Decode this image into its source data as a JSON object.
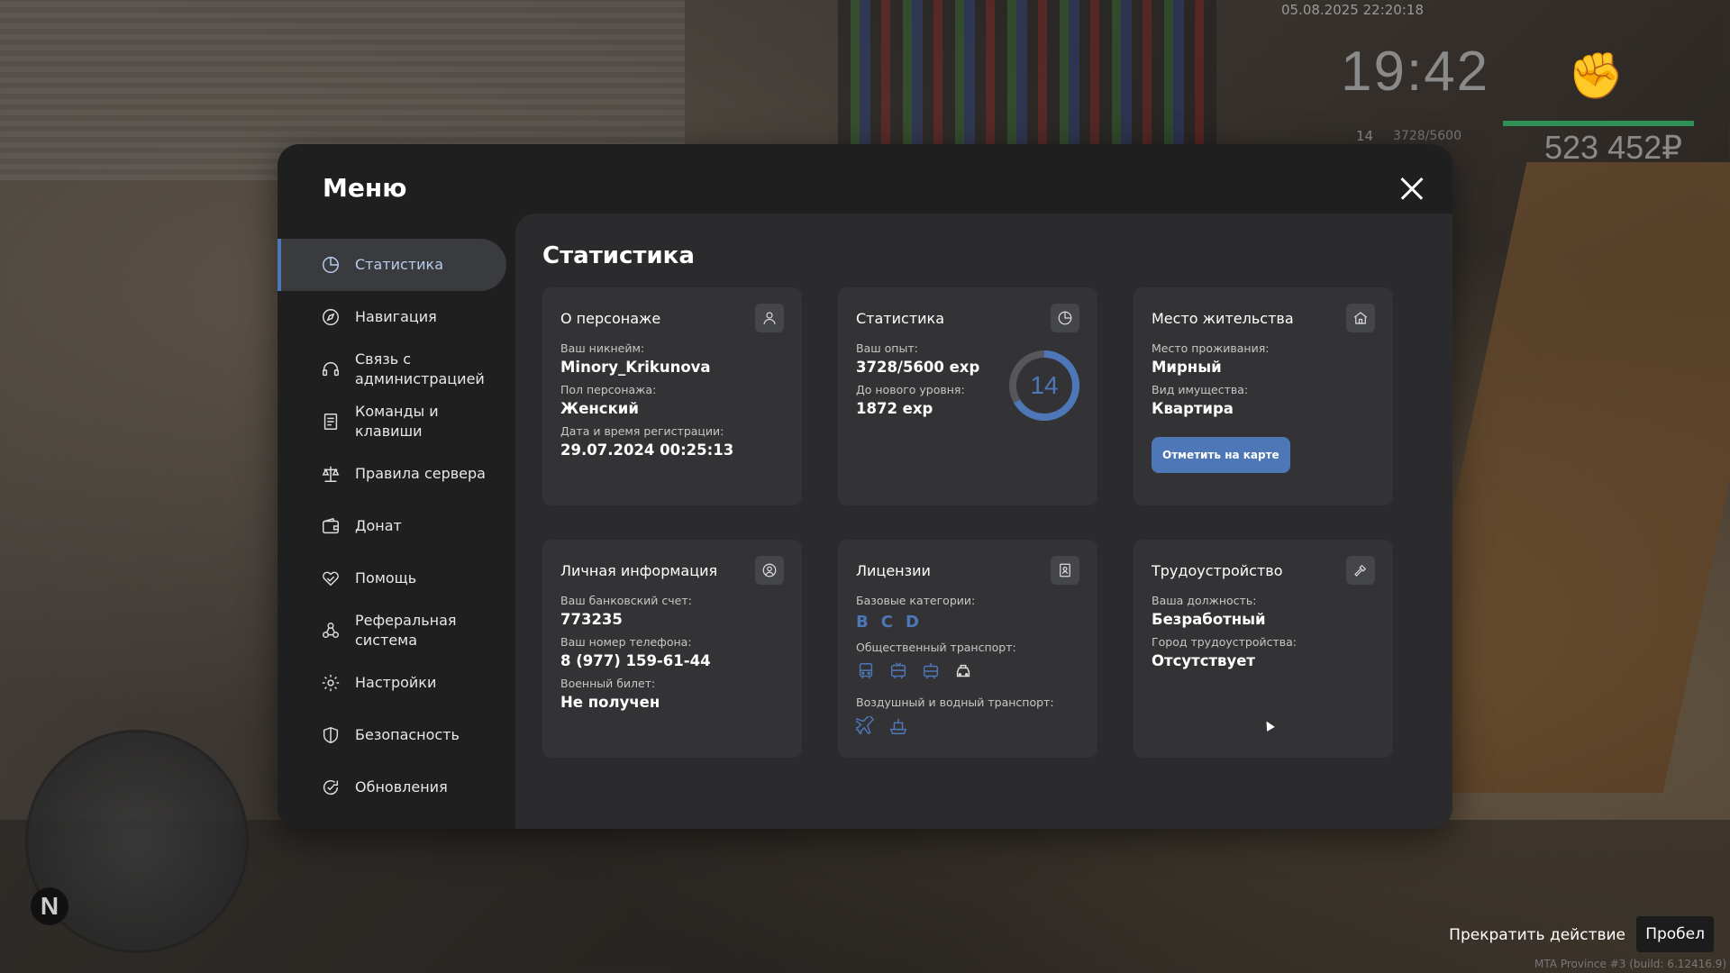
{
  "hud": {
    "datetime": "05.08.2025 22:20:18",
    "time": "19:42",
    "level": "14",
    "exp": "3728/5600",
    "money": "523 452₽",
    "compass": "N",
    "action_label": "Прекратить действие",
    "action_key": "Пробел",
    "build": "MTA Province #3 (build: 6.12416.9)"
  },
  "menu": {
    "title": "Меню",
    "items": [
      {
        "label": "Статистика",
        "icon": "pie-chart-icon"
      },
      {
        "label": "Навигация",
        "icon": "compass-icon"
      },
      {
        "label": "Связь с администрацией",
        "icon": "headset-icon"
      },
      {
        "label": "Команды и клавиши",
        "icon": "document-icon"
      },
      {
        "label": "Правила сервера",
        "icon": "scales-icon"
      },
      {
        "label": "Донат",
        "icon": "wallet-icon"
      },
      {
        "label": "Помощь",
        "icon": "handshake-icon"
      },
      {
        "label": "Реферальная система",
        "icon": "referral-icon"
      },
      {
        "label": "Настройки",
        "icon": "gear-icon"
      },
      {
        "label": "Безопасность",
        "icon": "shield-icon"
      },
      {
        "label": "Обновления",
        "icon": "refresh-icon"
      }
    ]
  },
  "page": {
    "title": "Статистика",
    "character": {
      "title": "О персонаже",
      "nick_label": "Ваш никнейм:",
      "nick": "Minory_Krikunova",
      "gender_label": "Пол персонажа:",
      "gender": "Женский",
      "reg_label": "Дата и время регистрации:",
      "reg": "29.07.2024 00:25:13"
    },
    "stats": {
      "title": "Статистика",
      "exp_label": "Ваш опыт:",
      "exp": "3728/5600 exp",
      "next_label": "До нового уровня:",
      "next": "1872 exp",
      "level": "14",
      "progress": 0.6657
    },
    "residence": {
      "title": "Место жительства",
      "place_label": "Место проживания:",
      "place": "Мирный",
      "type_label": "Вид имущества:",
      "type": "Квартира",
      "button": "Отметить на карте"
    },
    "personal": {
      "title": "Личная информация",
      "bank_label": "Ваш банковский счет:",
      "bank": "773235",
      "phone_label": "Ваш номер телефона:",
      "phone": "8 (977) 159-61-44",
      "military_label": "Военный билет:",
      "military": "Не получен"
    },
    "licenses": {
      "title": "Лицензии",
      "base_label": "Базовые категории:",
      "categories": [
        "B",
        "C",
        "D"
      ],
      "public_label": "Общественный транспорт:",
      "air_label": "Воздушный и водный транспорт:"
    },
    "employment": {
      "title": "Трудоустройство",
      "position_label": "Ваша должность:",
      "position": "Безработный",
      "city_label": "Город трудоустройства:",
      "city": "Отсутствует"
    }
  },
  "colors": {
    "accent": "#4e77b8",
    "panel": "#1f1f20",
    "card": "#333336"
  }
}
